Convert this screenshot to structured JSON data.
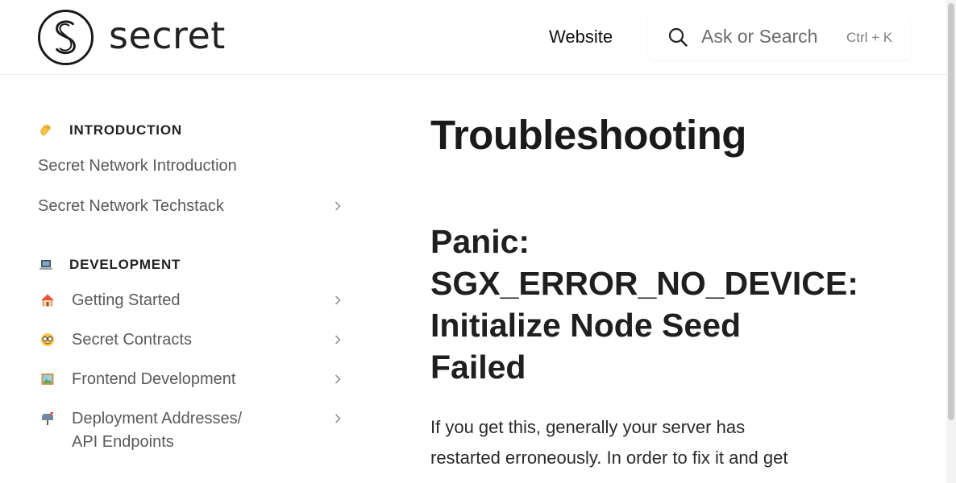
{
  "header": {
    "logo_text": "secret",
    "nav_link": "Website",
    "search": {
      "placeholder": "Ask or Search",
      "shortcut": "Ctrl + K"
    }
  },
  "sidebar": {
    "sections": [
      {
        "emoji": "waving-hand",
        "title": "INTRODUCTION",
        "items": [
          {
            "label": "Secret Network Introduction",
            "has_children": false
          },
          {
            "label": "Secret Network Techstack",
            "has_children": true
          }
        ]
      },
      {
        "emoji": "laptop",
        "title": "DEVELOPMENT",
        "items": [
          {
            "emoji": "house",
            "label": "Getting Started",
            "has_children": true
          },
          {
            "emoji": "nerd-face",
            "label": "Secret Contracts",
            "has_children": true
          },
          {
            "emoji": "framed-picture",
            "label": "Frontend Development",
            "has_children": true
          },
          {
            "emoji": "mailbox",
            "label_lines": [
              "Deployment Addresses/",
              "API Endpoints"
            ],
            "has_children": true
          }
        ]
      }
    ]
  },
  "main": {
    "title": "Troubleshooting",
    "section_title_lines": [
      "Panic:",
      "SGX_ERROR_NO_DEVICE:",
      "Initialize Node Seed",
      "Failed"
    ],
    "paragraph_lines": [
      "If you get this, generally your server has",
      "restarted erroneously. In order to fix it and get"
    ]
  },
  "colors": {
    "text_primary": "#1f1f1f",
    "text_muted": "#5a5a5a",
    "border": "#ebebeb"
  }
}
